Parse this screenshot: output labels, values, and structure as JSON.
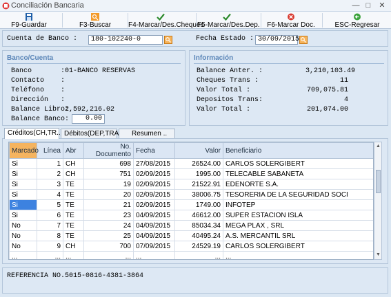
{
  "window": {
    "title": "Conciliación Bancaria"
  },
  "toolbar": {
    "buttons": [
      {
        "label": "F9-Guardar",
        "icon": "save-icon",
        "color": "#1f5fa8"
      },
      {
        "label": "F3-Buscar",
        "icon": "search-icon",
        "color": "#f39a2a"
      },
      {
        "label": "F4-Marcar/Des.Cheques",
        "icon": "check-icon",
        "color": "#2e8b2e"
      },
      {
        "label": "F5-Marcar/Des.Dep.",
        "icon": "check-icon",
        "color": "#2e8b2e"
      },
      {
        "label": "F6-Marcar Doc.",
        "icon": "cancel-icon",
        "color": "#d93a2f"
      },
      {
        "label": "ESC-Regresar",
        "icon": "back-icon",
        "color": "#3aa23a"
      }
    ]
  },
  "form": {
    "cuenta_label": "Cuenta de Banco  :",
    "cuenta_value": "180-102240-0",
    "fecha_label": "Fecha Estado  :",
    "fecha_value": "30/09/2015"
  },
  "banco": {
    "title": "Banco/Cuenta",
    "rows": [
      {
        "label": "Banco",
        "value": ":01-BANCO RESERVAS"
      },
      {
        "label": "Contacto",
        "value": ":"
      },
      {
        "label": "Teléfono",
        "value": ":"
      },
      {
        "label": "Dirección",
        "value": ":"
      },
      {
        "label": "Balance Libro:",
        "value": "2,592,216.02"
      }
    ],
    "balance_banco_label": "Balance Banco:",
    "balance_banco_value": "0.00"
  },
  "info": {
    "title": "Información",
    "rows": [
      {
        "label": "Balance Anter.  :",
        "value": "3,210,103.49"
      },
      {
        "label": "Cheques Trans   :",
        "value": "11"
      },
      {
        "label": "Valor Total     :",
        "value": "709,075.81"
      },
      {
        "label": "Depositos Trans:",
        "value": "4"
      },
      {
        "label": "Valor Total     :",
        "value": "201,074.00"
      }
    ]
  },
  "tabs": [
    "Créditos(CH,TR..)",
    "Débitos(DEP,TRA..)",
    "Resumen .."
  ],
  "grid": {
    "columns": [
      "Marcado",
      "Línea",
      "Abr",
      "No. Documento",
      "Fecha",
      "Valor",
      "Beneficiario"
    ],
    "rows": [
      [
        "Si",
        "1",
        "CH",
        "698",
        "27/08/2015",
        "26524.00",
        "CARLOS SOLERGIBERT"
      ],
      [
        "Si",
        "2",
        "CH",
        "751",
        "02/09/2015",
        "1995.00",
        "TELECABLE SABANETA"
      ],
      [
        "Si",
        "3",
        "TE",
        "19",
        "02/09/2015",
        "21522.91",
        "EDENORTE S.A."
      ],
      [
        "Si",
        "4",
        "TE",
        "20",
        "02/09/2015",
        "38006.75",
        "TESORERIA DE LA SEGURIDAD SOCI"
      ],
      [
        "Si",
        "5",
        "TE",
        "21",
        "02/09/2015",
        "1749.00",
        "INFOTEP"
      ],
      [
        "Si",
        "6",
        "TE",
        "23",
        "04/09/2015",
        "46612.00",
        "SUPER ESTACION ISLA"
      ],
      [
        "No",
        "7",
        "TE",
        "24",
        "04/09/2015",
        "85034.34",
        "MEGA PLAX , SRL"
      ],
      [
        "No",
        "8",
        "TE",
        "25",
        "04/09/2015",
        "40495.24",
        "A.S. MERCANTIL SRL"
      ],
      [
        "No",
        "9",
        "CH",
        "700",
        "07/09/2015",
        "24529.19",
        "CARLOS SOLERGIBERT"
      ],
      [
        "...",
        "...",
        "...",
        "...",
        "...",
        "...",
        "..."
      ]
    ],
    "selected_row": 5
  },
  "footer": {
    "text": "REFERENCIA NO.5015-0816-4381-3864"
  }
}
